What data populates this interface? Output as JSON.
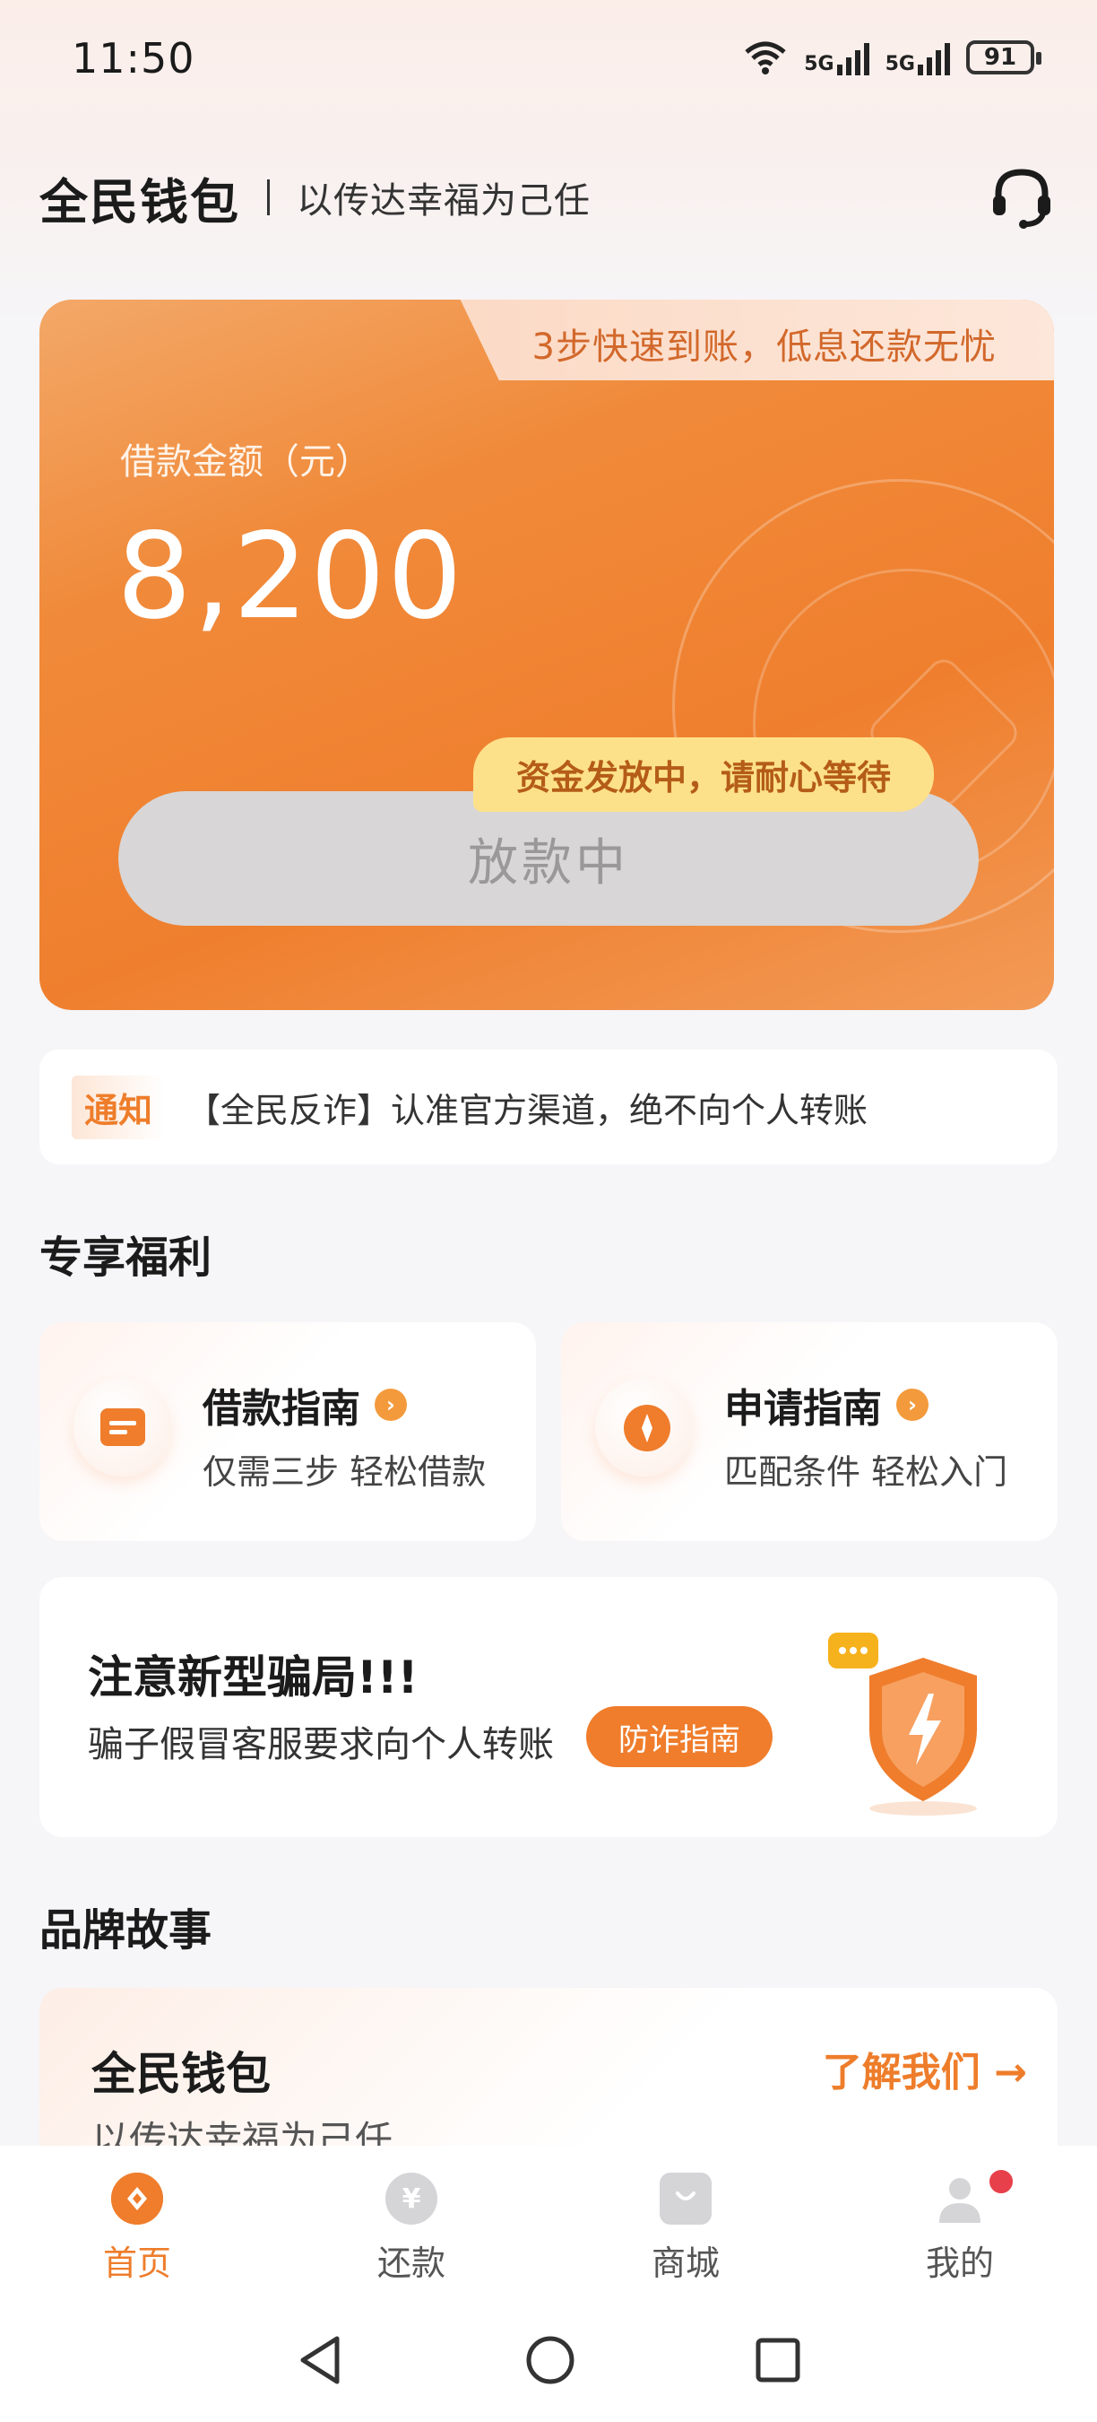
{
  "status_bar": {
    "time": "11:50",
    "network1": "5G",
    "network2": "5G",
    "battery": "91"
  },
  "header": {
    "brand": "全民钱包",
    "slogan": "以传达幸福为己任"
  },
  "loan_card": {
    "tab_text": "3步快速到账，低息还款无忧",
    "amount_label": "借款金额（元）",
    "amount": "8,200",
    "release_tip": "资金发放中，请耐心等待",
    "release_button": "放款中"
  },
  "notice": {
    "tag": "通知",
    "text": "【全民反诈】认准官方渠道，绝不向个人转账"
  },
  "benefits": {
    "title": "专享福利",
    "items": [
      {
        "title": "借款指南",
        "desc": "仅需三步 轻松借款"
      },
      {
        "title": "申请指南",
        "desc": "匹配条件 轻松入门"
      }
    ]
  },
  "scam_alert": {
    "title": "注意新型骗局!!!",
    "desc": "骗子假冒客服要求向个人转账",
    "button": "防诈指南"
  },
  "brand_story": {
    "section_title": "品牌故事",
    "title": "全民钱包",
    "subtitle": "以传达幸福为己任",
    "link": "了解我们 →"
  },
  "tabbar": {
    "items": [
      {
        "label": "首页",
        "icon": "home-icon"
      },
      {
        "label": "还款",
        "icon": "yen-icon"
      },
      {
        "label": "商城",
        "icon": "shopping-bag-icon"
      },
      {
        "label": "我的",
        "icon": "user-icon"
      }
    ]
  },
  "colors": {
    "accent": "#ef7d2c",
    "tip_bg": "#fde18a",
    "disabled_btn": "#d8d6d6"
  }
}
